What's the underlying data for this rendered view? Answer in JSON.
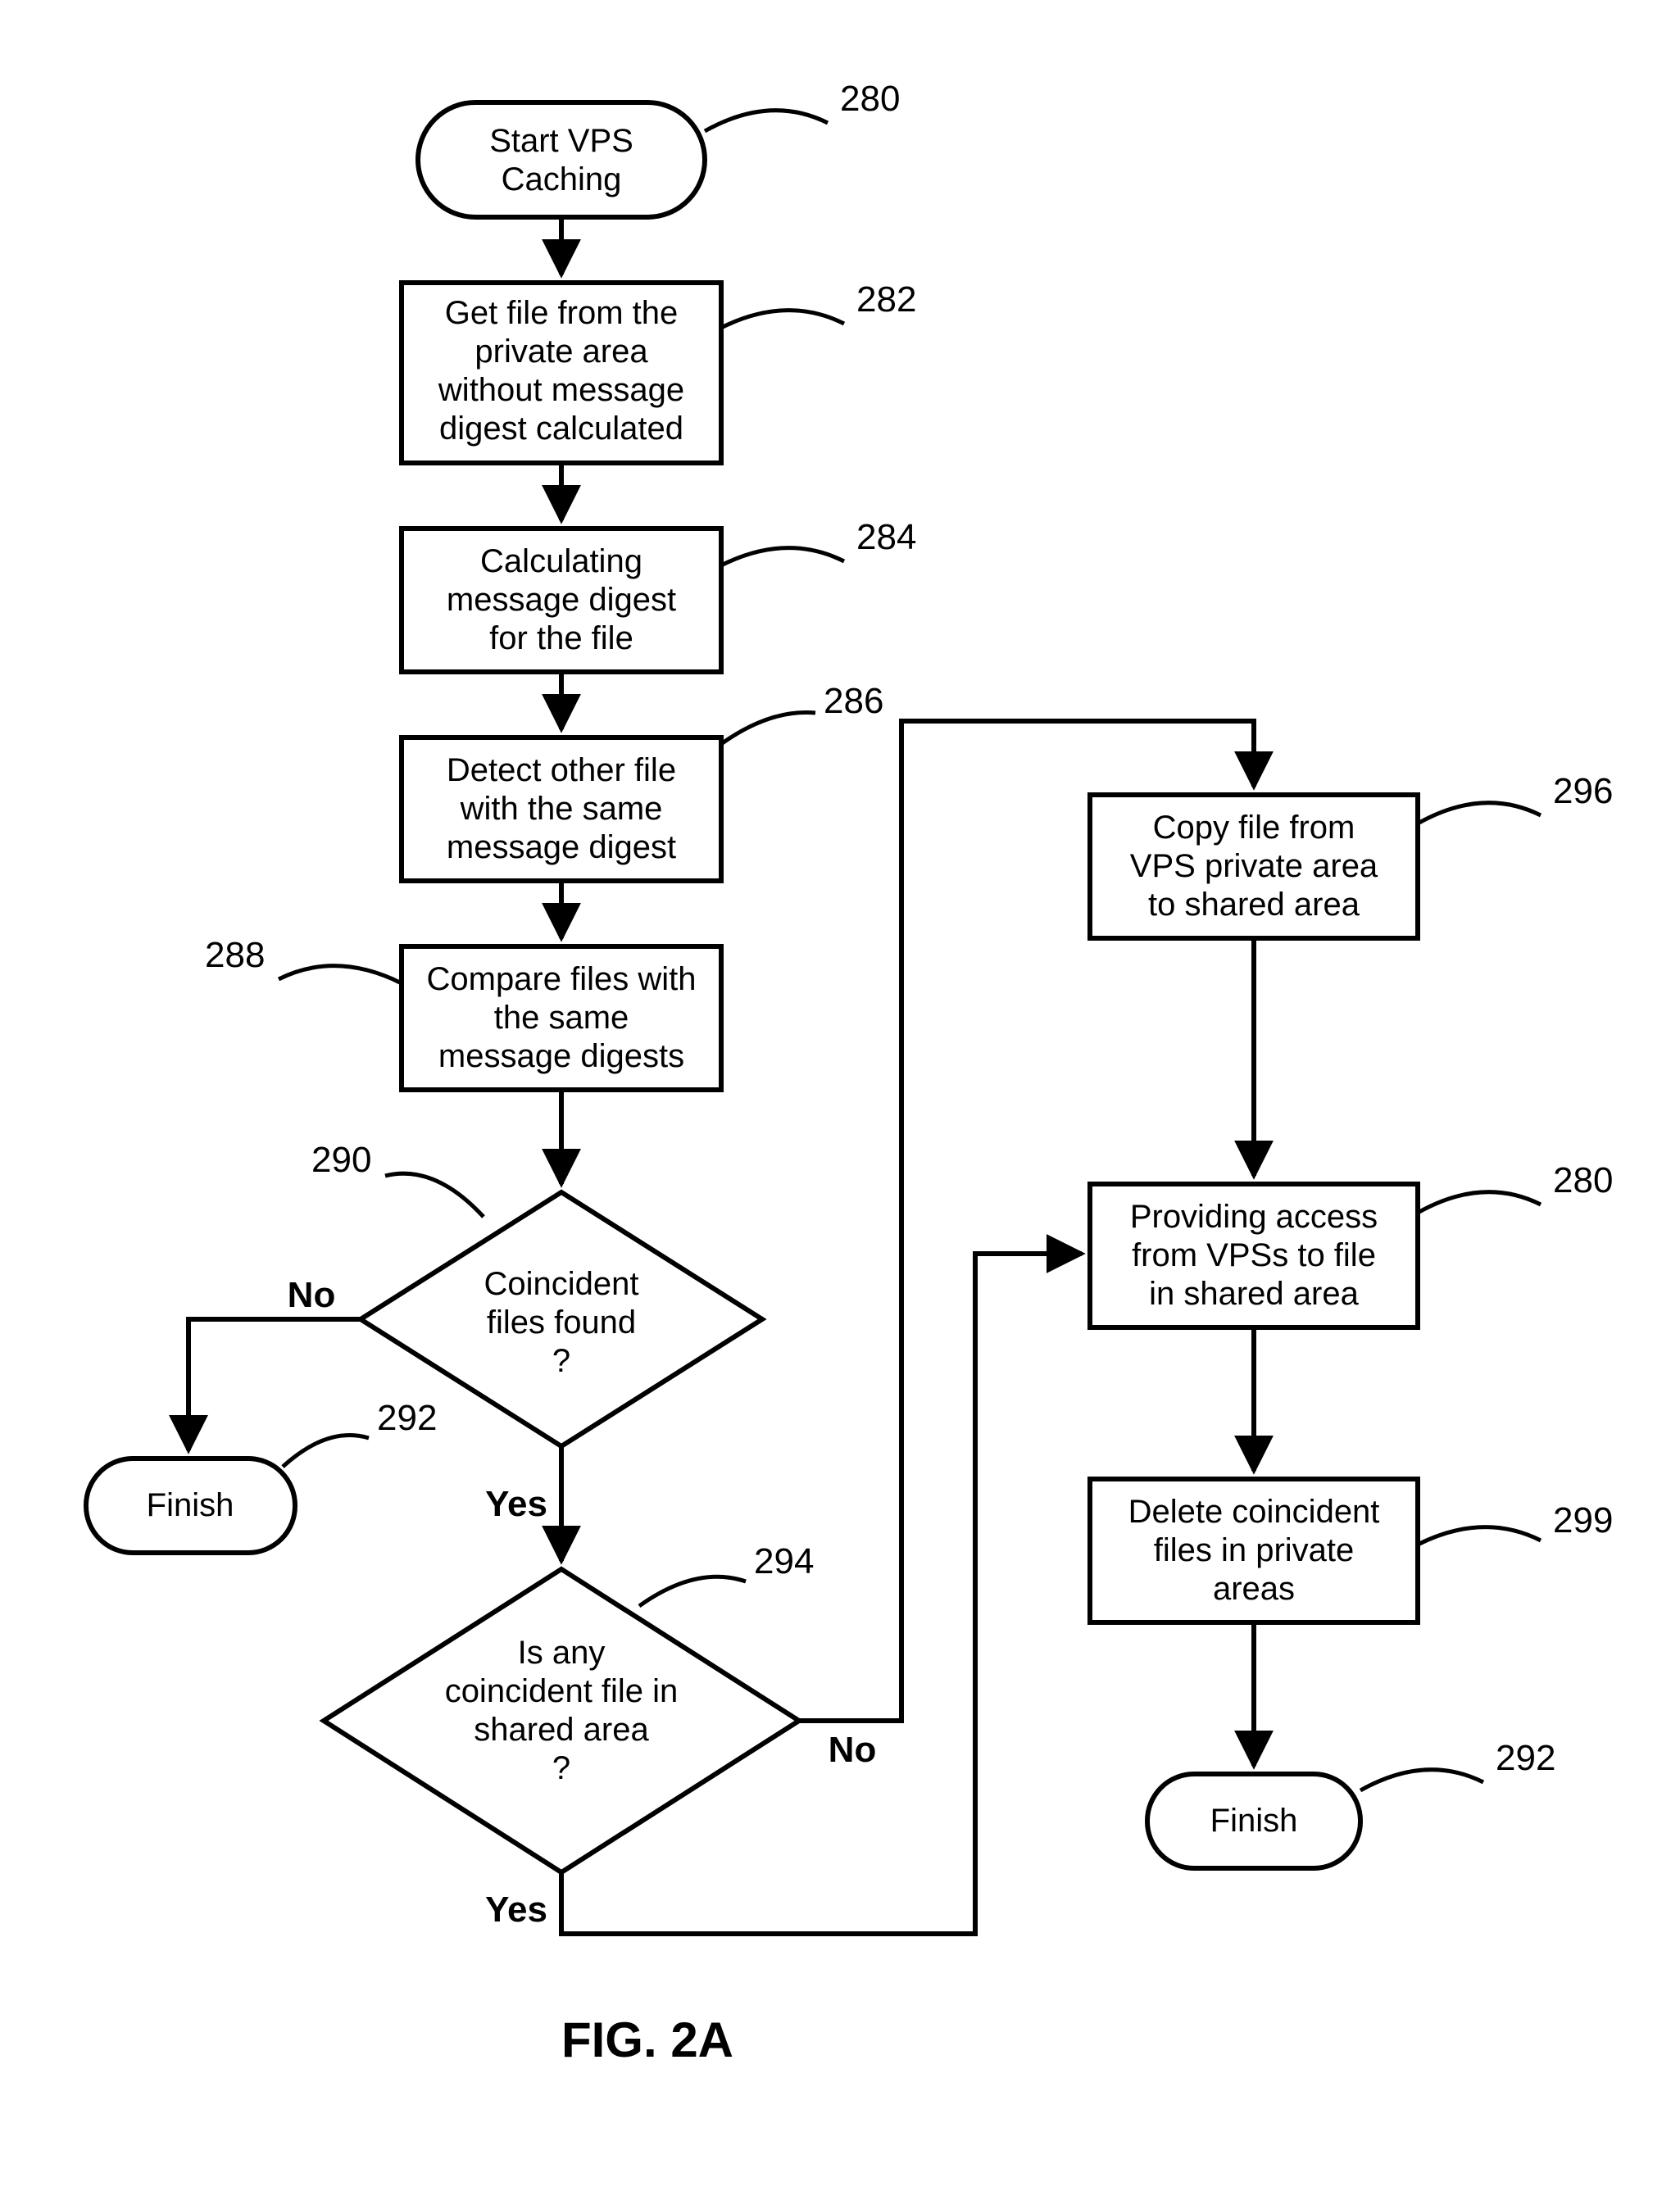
{
  "figure_label": "FIG. 2A",
  "nodes": {
    "n280a": {
      "num": "280",
      "lines": [
        "Start VPS",
        "Caching"
      ]
    },
    "n282": {
      "num": "282",
      "lines": [
        "Get file from the",
        "private area",
        "without message",
        "digest calculated"
      ]
    },
    "n284": {
      "num": "284",
      "lines": [
        "Calculating",
        "message digest",
        "for the file"
      ]
    },
    "n286": {
      "num": "286",
      "lines": [
        "Detect other file",
        "with the same",
        "message digest"
      ]
    },
    "n288": {
      "num": "288",
      "lines": [
        "Compare files with",
        "the same",
        "message digests"
      ]
    },
    "n290": {
      "num": "290",
      "lines": [
        "Coincident",
        "files found",
        "?"
      ]
    },
    "n292a": {
      "num": "292",
      "lines": [
        "Finish"
      ]
    },
    "n294": {
      "num": "294",
      "lines": [
        "Is any",
        "coincident file in",
        "shared area",
        "?"
      ]
    },
    "n296": {
      "num": "296",
      "lines": [
        "Copy file from",
        "VPS private area",
        "to shared area"
      ]
    },
    "n280b": {
      "num": "280",
      "lines": [
        "Providing access",
        "from VPSs to file",
        "in shared area"
      ]
    },
    "n299": {
      "num": "299",
      "lines": [
        "Delete coincident",
        "files in private",
        "areas"
      ]
    },
    "n292b": {
      "num": "292",
      "lines": [
        "Finish"
      ]
    }
  },
  "edges": {
    "e290_no": "No",
    "e290_yes": "Yes",
    "e294_no": "No",
    "e294_yes": "Yes"
  }
}
